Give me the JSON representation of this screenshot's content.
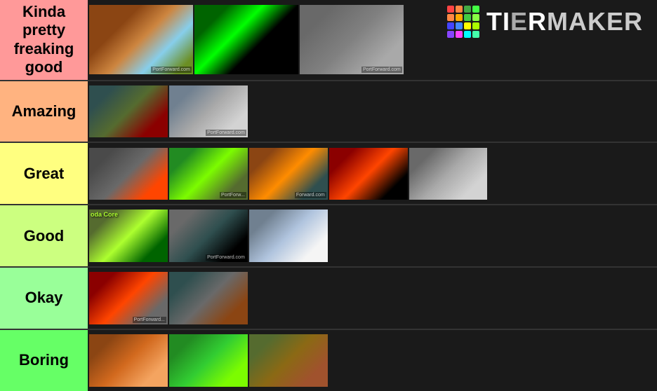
{
  "logo": {
    "text": "TierMaker",
    "tier_part": "Tier",
    "maker_part": "maker"
  },
  "logo_dots": [
    {
      "color": "#ff4444"
    },
    {
      "color": "#ff8844"
    },
    {
      "color": "#44aa44"
    },
    {
      "color": "#44ff44"
    },
    {
      "color": "#ff8844"
    },
    {
      "color": "#ffaa00"
    },
    {
      "color": "#44cc44"
    },
    {
      "color": "#88ff44"
    },
    {
      "color": "#4444ff"
    },
    {
      "color": "#4488ff"
    },
    {
      "color": "#ffff00"
    },
    {
      "color": "#aaff00"
    },
    {
      "color": "#8844ff"
    },
    {
      "color": "#ff44ff"
    },
    {
      "color": "#00ffff"
    },
    {
      "color": "#44ffaa"
    }
  ],
  "tiers": [
    {
      "id": "kinda",
      "label": "Kinda pretty freaking good",
      "color": "#ff9999",
      "item_count": 3
    },
    {
      "id": "amazing",
      "label": "Amazing",
      "color": "#ffb380",
      "item_count": 2
    },
    {
      "id": "great",
      "label": "Great",
      "color": "#ffff80",
      "item_count": 5
    },
    {
      "id": "good",
      "label": "Good",
      "color": "#ccff80",
      "item_count": 3
    },
    {
      "id": "okay",
      "label": "Okay",
      "color": "#99ff99",
      "item_count": 2
    },
    {
      "id": "boring",
      "label": "Boring",
      "color": "#66ff66",
      "item_count": 3
    }
  ]
}
